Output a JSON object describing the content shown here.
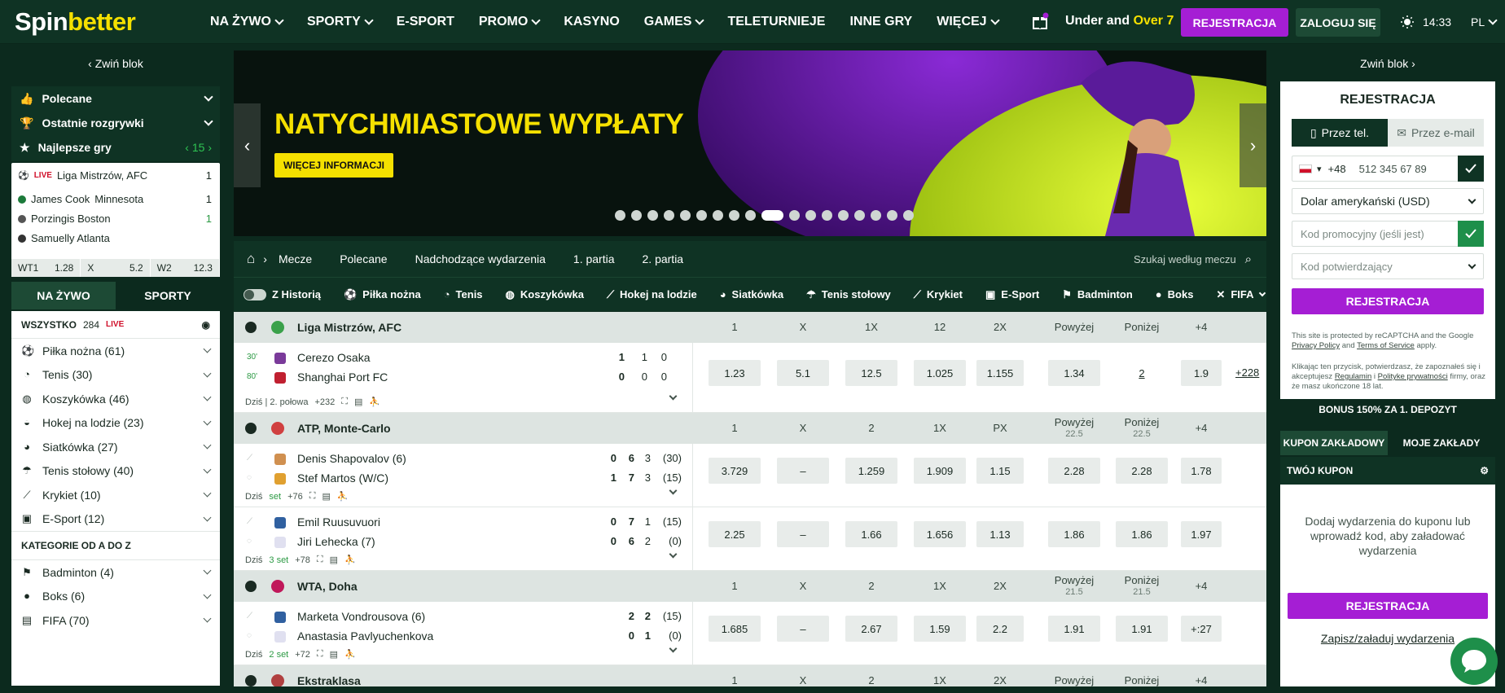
{
  "header": {
    "logo_a": "Spin",
    "logo_b": "better",
    "nav": [
      "NA ŻYWO",
      "SPORTY",
      "E-SPORT",
      "PROMO",
      "KASYNO",
      "GAMES",
      "TELETURNIEJE",
      "INNE GRY",
      "WIĘCEJ"
    ],
    "nav_has_chevron": [
      true,
      true,
      false,
      true,
      false,
      true,
      false,
      false,
      true
    ],
    "promo_a": "Under and ",
    "promo_b": "Over 7",
    "register": "REJESTRACJA",
    "login": "ZALOGUJ SIĘ",
    "time": "14:33",
    "lang": "PL"
  },
  "left": {
    "collapse": "Zwiń blok",
    "menu": [
      {
        "label": "Polecane",
        "icon": "thumbs-up-icon"
      },
      {
        "label": "Ostatnie rozgrywki",
        "icon": "trophy-icon"
      },
      {
        "label": "Najlepsze gry",
        "icon": "star-icon",
        "count": "15"
      }
    ],
    "card": {
      "live": "LIVE",
      "title": "Liga Mistrzów, AFC",
      "title_count": "1",
      "rows": [
        {
          "name": "James Cook",
          "team": "Minnesota",
          "val": "1"
        },
        {
          "name": "Porzingis Boston",
          "team": "",
          "val": "1"
        },
        {
          "name": "Samuelly Atlanta",
          "team": "",
          "val": ""
        }
      ],
      "odds": [
        [
          "WT1",
          "1.28"
        ],
        [
          "X",
          "5.2"
        ],
        [
          "W2",
          "12.3"
        ]
      ]
    },
    "tabs": [
      "NA ŻYWO",
      "SPORTY"
    ],
    "all_label": "WSZYSTKO",
    "all_count": "284",
    "live_label": "LIVE",
    "sports": [
      "Piłka nożna (61)",
      "Tenis (30)",
      "Koszykówka (46)",
      "Hokej na lodzie (23)",
      "Siatkówka (27)",
      "Tenis stołowy (40)",
      "Krykiet (10)",
      "E-Sport (12)"
    ],
    "cat_head": "KATEGORIE OD A DO Z",
    "cats": [
      "Badminton (4)",
      "Boks (6)",
      "FIFA (70)"
    ]
  },
  "banner": {
    "title": "NATYCHMIASTOWE WYPŁATY",
    "button": "WIĘCEJ INFORMACJI",
    "dot_count": 18,
    "active_dot": 9
  },
  "crumb": {
    "items": [
      "Mecze",
      "Polecane",
      "Nadchodzące wydarzenia",
      "1. partia",
      "2. partia"
    ],
    "search": "Szukaj według meczu"
  },
  "sport_tabs": [
    "Z Historią",
    "Piłka nożna",
    "Tenis",
    "Koszykówka",
    "Hokej na lodzie",
    "Siatkówka",
    "Tenis stołowy",
    "Krykiet",
    "E-Sport",
    "Badminton",
    "Boks",
    "FIFA"
  ],
  "events": {
    "leagues": [
      {
        "name": "Liga Mistrzów, AFC",
        "cols": [
          "1",
          "X",
          "1X",
          "12",
          "2X",
          "Powyżej",
          "Poniżej",
          "+4"
        ],
        "subs": [
          "",
          "",
          "",
          "",
          "",
          "",
          "",
          ""
        ],
        "matches": [
          {
            "teams": [
              "Cerezo Osaka",
              "Shanghai Port FC"
            ],
            "minute": [
              "30'",
              "80'"
            ],
            "scores": [
              [
                "1",
                "1",
                "0"
              ],
              [
                "0",
                "0",
                "0"
              ]
            ],
            "foot": "Dziś | 2. połowa",
            "more": "+232",
            "odds": [
              "1.23",
              "5.1",
              "12.5",
              "1.025",
              "1.155",
              "1.34",
              "2",
              "1.9"
            ],
            "extra": "+228"
          }
        ]
      },
      {
        "name": "ATP, Monte-Carlo",
        "cols": [
          "1",
          "X",
          "2",
          "1X",
          "PX",
          "Powyżej",
          "Poniżej",
          "+4"
        ],
        "subs": [
          "",
          "",
          "",
          "",
          "",
          "22.5",
          "22.5",
          ""
        ],
        "matches": [
          {
            "teams": [
              "Denis Shapovalov (6)",
              "Stef Martos (W/C)"
            ],
            "scores": [
              [
                "0",
                "6",
                "3",
                "(30)"
              ],
              [
                "1",
                "7",
                "3",
                "(15)"
              ]
            ],
            "foot": "Dziś",
            "set": "set",
            "more": "+76",
            "odds": [
              "3.729",
              "–",
              "1.259",
              "1.909",
              "1.15",
              "2.28",
              "2.28",
              "1.78"
            ]
          },
          {
            "teams": [
              "Emil Ruusuvuori",
              "Jiri Lehecka (7)"
            ],
            "scores": [
              [
                "0",
                "7",
                "1",
                "(15)"
              ],
              [
                "0",
                "6",
                "2",
                "(0)"
              ]
            ],
            "foot": "Dziś",
            "set": "3 set",
            "more": "+78",
            "odds": [
              "2.25",
              "–",
              "1.66",
              "1.656",
              "1.13",
              "1.86",
              "1.86",
              "1.97"
            ]
          }
        ]
      },
      {
        "name": "WTA, Doha",
        "cols": [
          "1",
          "X",
          "2",
          "1X",
          "2X",
          "Powyżej",
          "Poniżej",
          "+4"
        ],
        "subs": [
          "",
          "",
          "",
          "",
          "",
          "21.5",
          "21.5",
          ""
        ],
        "matches": [
          {
            "teams": [
              "Marketa Vondrousova (6)",
              "Anastasia Pavlyuchenkova"
            ],
            "scores": [
              [
                "2",
                "2",
                "(15)"
              ],
              [
                "0",
                "1",
                "(0)"
              ]
            ],
            "foot": "Dziś",
            "set": "2 set",
            "more": "+72",
            "odds": [
              "1.685",
              "–",
              "2.67",
              "1.59",
              "2.2",
              "1.91",
              "1.91",
              "+:27"
            ]
          }
        ]
      },
      {
        "name": "Ekstraklasa",
        "cols": [
          "1",
          "X",
          "2",
          "1X",
          "2X",
          "Powyżej",
          "Poniżej",
          "+4"
        ],
        "subs": [
          "",
          "",
          "",
          "",
          "",
          "",
          "",
          ""
        ],
        "matches": []
      }
    ]
  },
  "right": {
    "collapse": "Zwiń blok",
    "title": "REJESTRACJA",
    "tab_phone": "Przez tel.",
    "tab_email": "Przez e-mail",
    "phone_prefix": "+48",
    "phone_placeholder": "512 345 67 89",
    "currency": "Dolar amerykański (USD)",
    "promo_placeholder": "Kod promocyjny (jeśli jest)",
    "confirm_placeholder": "Kod potwierdzający",
    "register": "REJESTRACJA",
    "recaptcha": "This site is protected by reCAPTCHA and the Google",
    "recaptcha_policy": "Privacy Policy",
    "recaptcha_and": "and",
    "recaptcha_tos": "Terms of Service",
    "recaptcha_end": "apply.",
    "consent_a": "Klikając ten przycisk, potwierdzasz, że zapoznałeś się i akceptujesz",
    "consent_rules": "Regulamin",
    "consent_i": "i",
    "consent_policy": "Polityke prywatności",
    "consent_b": "firmy, oraz że masz ukończone 18 lat.",
    "bonus": "BONUS 150% ZA 1. DEPOZYT",
    "kup_tabs": [
      "KUPON ZAKŁADOWY",
      "MOJE ZAKŁADY"
    ],
    "kup_title": "TWÓJ KUPON",
    "kup_msg": "Dodaj wydarzenia do kuponu lub wprowadź kod, aby załadować wydarzenia",
    "kup_btn": "REJESTRACJA",
    "kup_link": "Zapisz/załaduj wydarzenia"
  },
  "colors": {
    "accent_purple": "#a51ed4",
    "brand_yellow": "#f5e000",
    "header_green": "#0f3324"
  }
}
